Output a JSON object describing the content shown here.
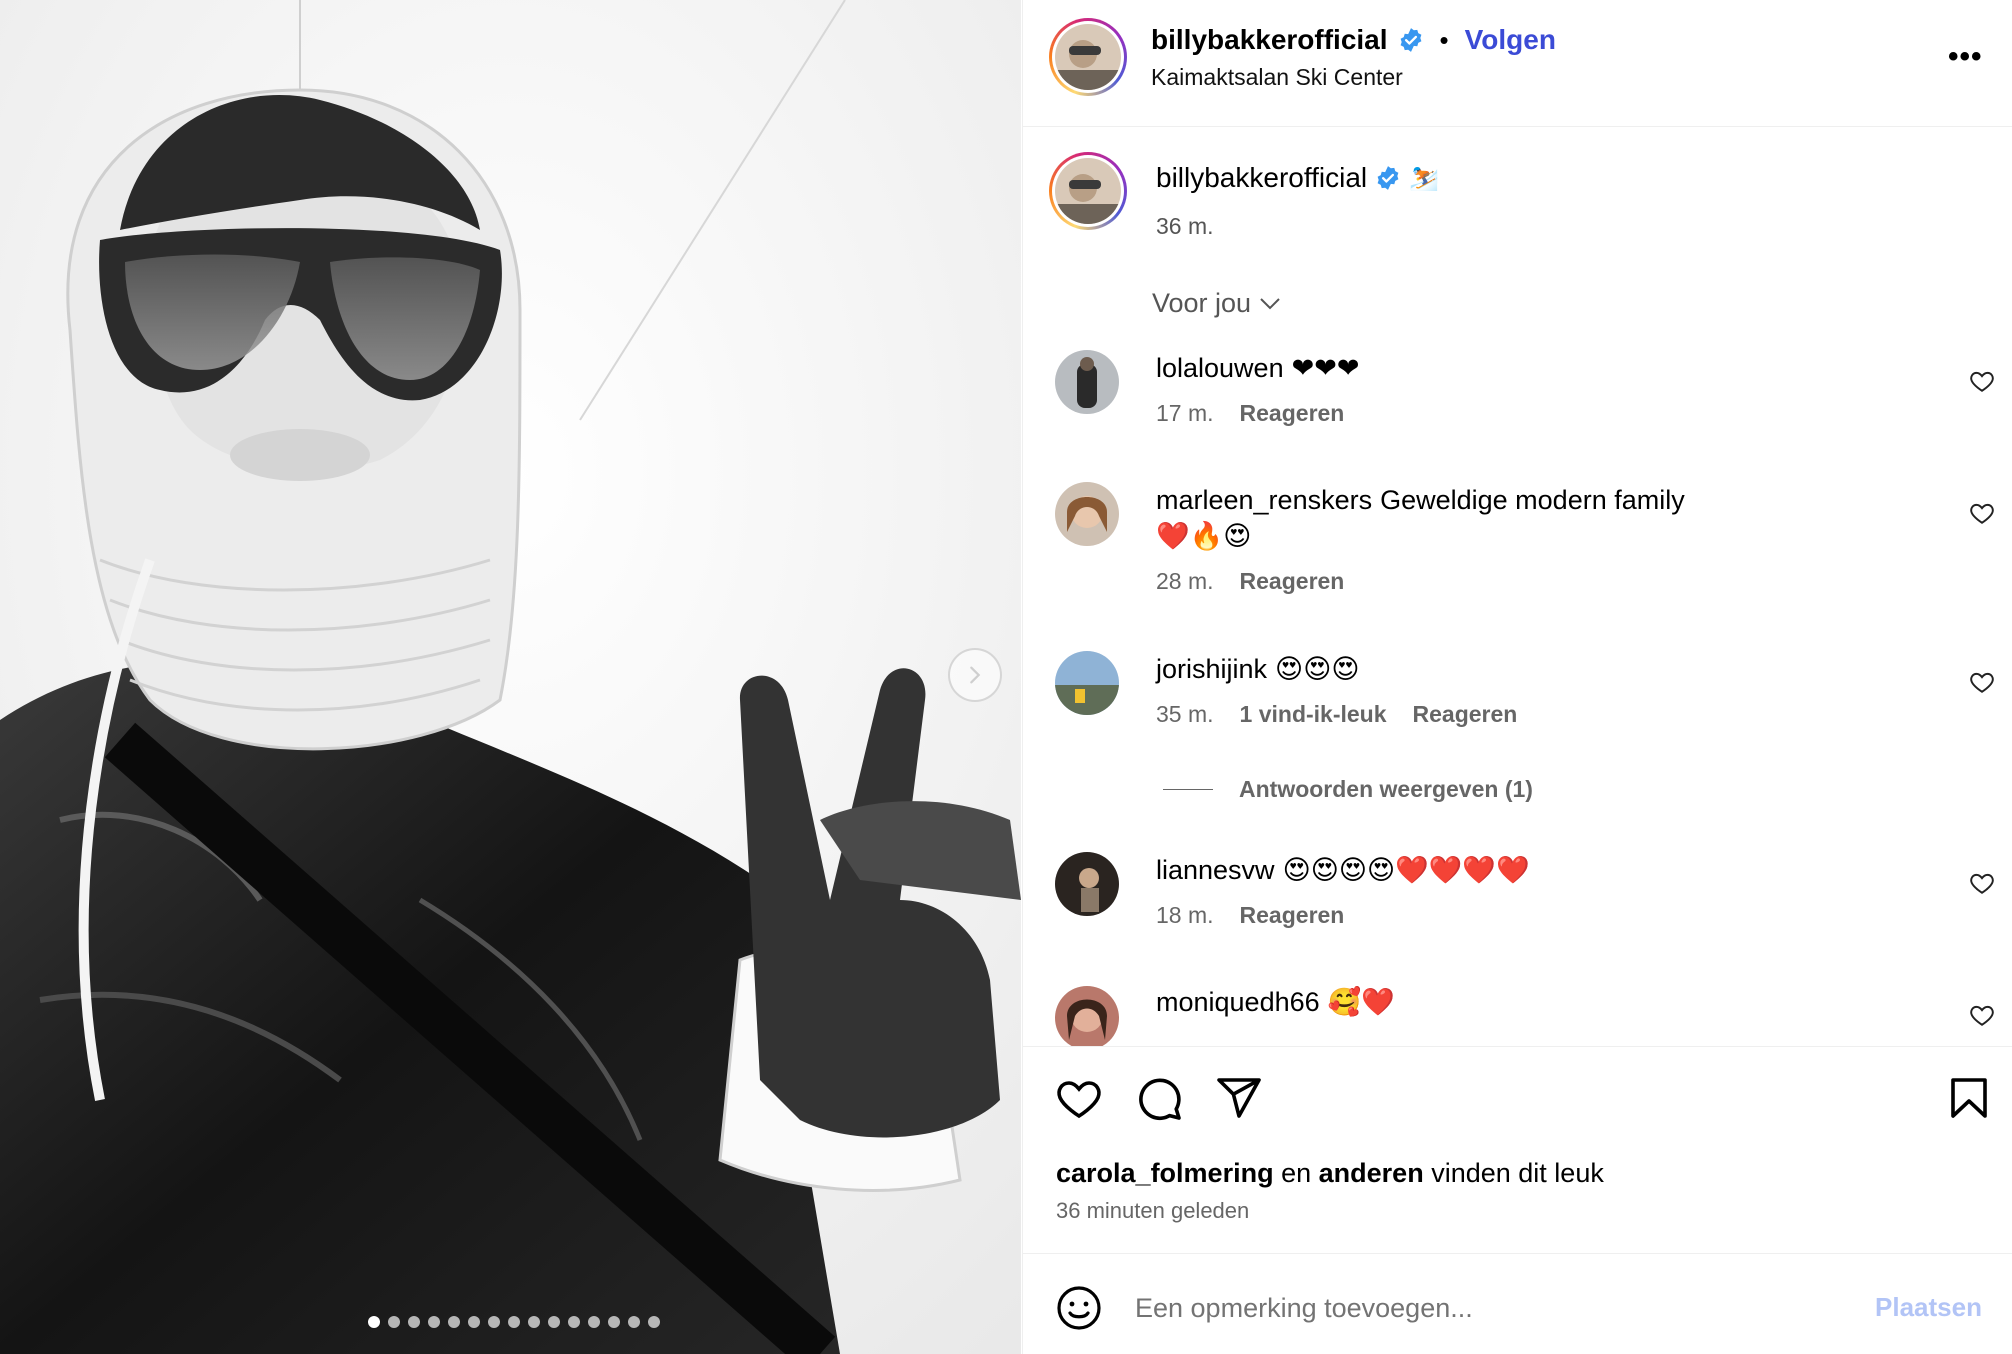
{
  "post": {
    "author": "billybakkerofficial",
    "follow_label": "Volgen",
    "separator": "•",
    "location": "Kaimaktsalan Ski Center",
    "more_label": "•••",
    "caption_emoji": "⛷️",
    "caption_time": "36 m."
  },
  "filter": {
    "label": "Voor jou"
  },
  "comments": [
    {
      "user": "lolalouwen",
      "text": "❤❤❤",
      "time": "17 m.",
      "likes": "",
      "reply": "Reageren"
    },
    {
      "user": "marleen_renskers",
      "text": "Geweldige modern family",
      "text2": "❤️🔥😍",
      "time": "28 m.",
      "likes": "",
      "reply": "Reageren"
    },
    {
      "user": "jorishijink",
      "text": "😍😍😍",
      "time": "35 m.",
      "likes": "1 vind-ik-leuk",
      "reply": "Reageren"
    },
    {
      "user": "liannesvw",
      "text": "😍😍😍😍❤️❤️❤️❤️",
      "time": "18 m.",
      "likes": "",
      "reply": "Reageren"
    },
    {
      "user": "moniquedh66",
      "text": "🥰❤️",
      "time": "",
      "likes": "",
      "reply": ""
    }
  ],
  "view_replies": "Antwoorden weergeven (1)",
  "likes": {
    "first": "carola_folmering",
    "middle": "en",
    "second": "anderen",
    "suffix": "vinden dit leuk"
  },
  "posted": "36 minuten geleden",
  "composer": {
    "placeholder": "Een opmerking toevoegen...",
    "post_label": "Plaatsen"
  },
  "carousel": {
    "total": 15,
    "current": 1
  },
  "colors": {
    "follow": "#3b4bd6",
    "verified": "#3897f0",
    "post_disabled": "#b2c4f6"
  }
}
